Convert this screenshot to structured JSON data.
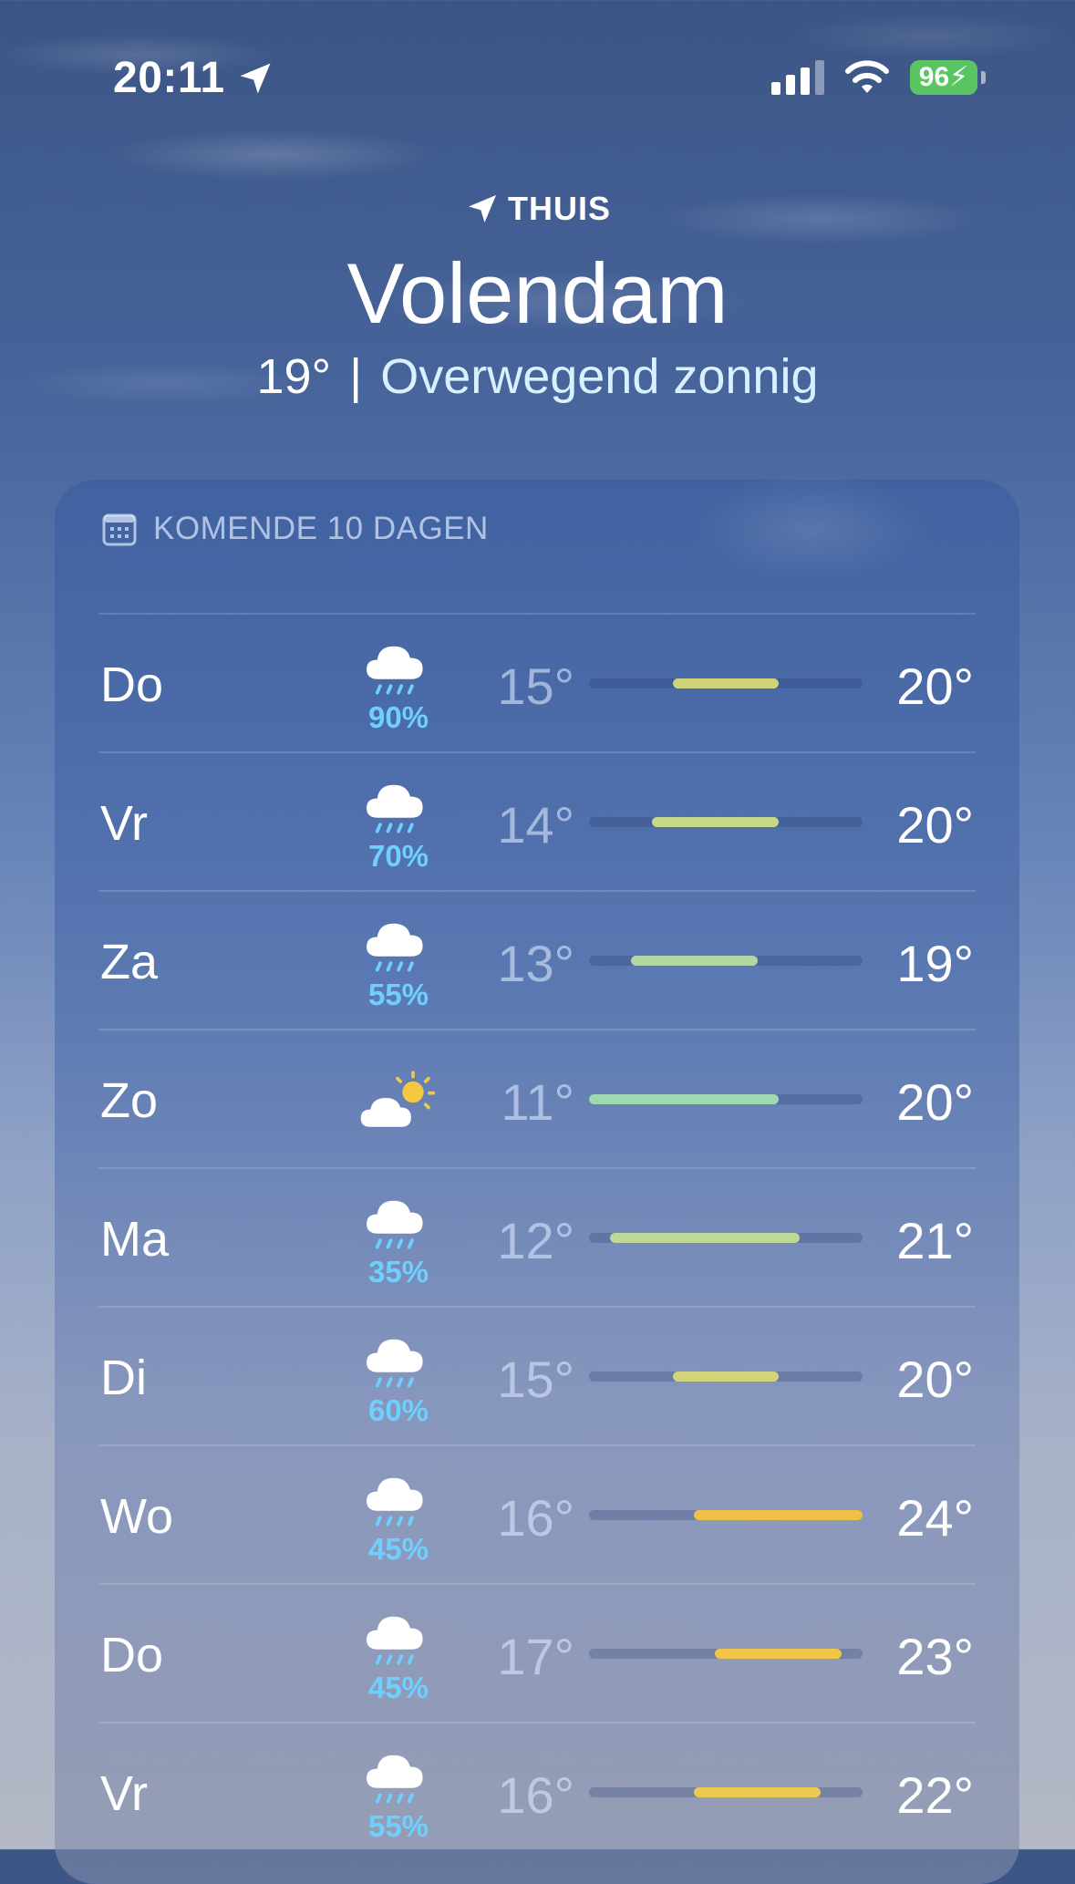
{
  "status_bar": {
    "time": "20:11",
    "battery": "96",
    "icons": [
      "location-arrow-icon",
      "cellular-signal-icon",
      "wifi-icon",
      "battery-charging-icon"
    ]
  },
  "header": {
    "location_label": "THUIS",
    "city": "Volendam",
    "current_temp": "19°",
    "separator": "|",
    "condition": "Overwegend zonnig"
  },
  "forecast": {
    "title": "KOMENDE 10 DAGEN",
    "range_min": 11,
    "range_max": 24,
    "days": [
      {
        "day": "Do",
        "icon": "cloud-rain-icon",
        "precip": "90%",
        "min": "15°",
        "max": "20°",
        "min_val": 15,
        "max_val": 20,
        "color": "#cfd37a"
      },
      {
        "day": "Vr",
        "icon": "cloud-rain-icon",
        "precip": "70%",
        "min": "14°",
        "max": "20°",
        "min_val": 14,
        "max_val": 20,
        "color": "#c6d78a"
      },
      {
        "day": "Za",
        "icon": "cloud-rain-icon",
        "precip": "55%",
        "min": "13°",
        "max": "19°",
        "min_val": 13,
        "max_val": 19,
        "color": "#b3d7a0"
      },
      {
        "day": "Zo",
        "icon": "sun-behind-cloud-icon",
        "precip": "",
        "min": "11°",
        "max": "20°",
        "min_val": 11,
        "max_val": 20,
        "color": "#9ed9b2"
      },
      {
        "day": "Ma",
        "icon": "cloud-rain-icon",
        "precip": "35%",
        "min": "12°",
        "max": "21°",
        "min_val": 12,
        "max_val": 21,
        "color": "#c0d896"
      },
      {
        "day": "Di",
        "icon": "cloud-rain-icon",
        "precip": "60%",
        "min": "15°",
        "max": "20°",
        "min_val": 15,
        "max_val": 20,
        "color": "#d2d37a"
      },
      {
        "day": "Wo",
        "icon": "cloud-rain-icon",
        "precip": "45%",
        "min": "16°",
        "max": "24°",
        "min_val": 16,
        "max_val": 24,
        "color": "#efc048"
      },
      {
        "day": "Do",
        "icon": "cloud-rain-icon",
        "precip": "45%",
        "min": "17°",
        "max": "23°",
        "min_val": 17,
        "max_val": 23,
        "color": "#f1c547"
      },
      {
        "day": "Vr",
        "icon": "cloud-rain-icon",
        "precip": "55%",
        "min": "16°",
        "max": "22°",
        "min_val": 16,
        "max_val": 22,
        "color": "#ecc950"
      }
    ]
  }
}
